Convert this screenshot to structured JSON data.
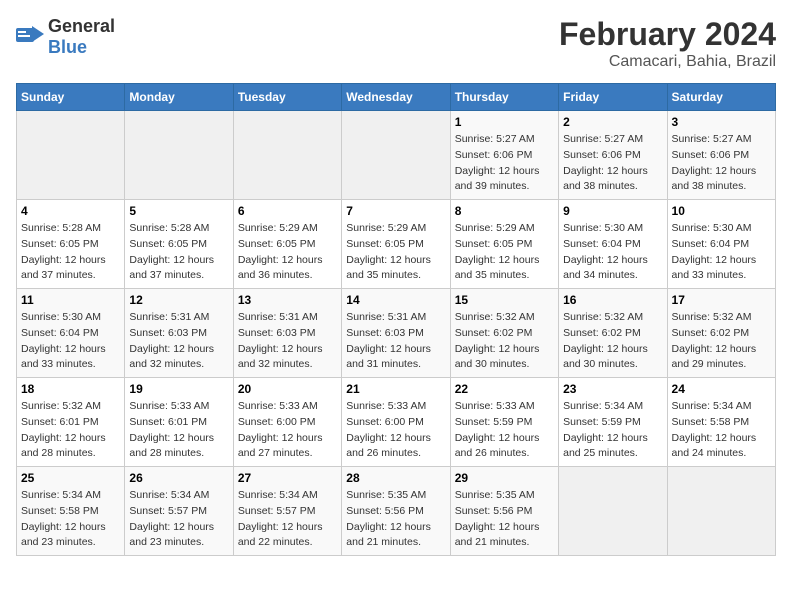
{
  "header": {
    "logo_general": "General",
    "logo_blue": "Blue",
    "month_year": "February 2024",
    "location": "Camacari, Bahia, Brazil"
  },
  "columns": [
    "Sunday",
    "Monday",
    "Tuesday",
    "Wednesday",
    "Thursday",
    "Friday",
    "Saturday"
  ],
  "weeks": [
    [
      {
        "day": "",
        "info": ""
      },
      {
        "day": "",
        "info": ""
      },
      {
        "day": "",
        "info": ""
      },
      {
        "day": "",
        "info": ""
      },
      {
        "day": "1",
        "info": "Sunrise: 5:27 AM\nSunset: 6:06 PM\nDaylight: 12 hours\nand 39 minutes."
      },
      {
        "day": "2",
        "info": "Sunrise: 5:27 AM\nSunset: 6:06 PM\nDaylight: 12 hours\nand 38 minutes."
      },
      {
        "day": "3",
        "info": "Sunrise: 5:27 AM\nSunset: 6:06 PM\nDaylight: 12 hours\nand 38 minutes."
      }
    ],
    [
      {
        "day": "4",
        "info": "Sunrise: 5:28 AM\nSunset: 6:05 PM\nDaylight: 12 hours\nand 37 minutes."
      },
      {
        "day": "5",
        "info": "Sunrise: 5:28 AM\nSunset: 6:05 PM\nDaylight: 12 hours\nand 37 minutes."
      },
      {
        "day": "6",
        "info": "Sunrise: 5:29 AM\nSunset: 6:05 PM\nDaylight: 12 hours\nand 36 minutes."
      },
      {
        "day": "7",
        "info": "Sunrise: 5:29 AM\nSunset: 6:05 PM\nDaylight: 12 hours\nand 35 minutes."
      },
      {
        "day": "8",
        "info": "Sunrise: 5:29 AM\nSunset: 6:05 PM\nDaylight: 12 hours\nand 35 minutes."
      },
      {
        "day": "9",
        "info": "Sunrise: 5:30 AM\nSunset: 6:04 PM\nDaylight: 12 hours\nand 34 minutes."
      },
      {
        "day": "10",
        "info": "Sunrise: 5:30 AM\nSunset: 6:04 PM\nDaylight: 12 hours\nand 33 minutes."
      }
    ],
    [
      {
        "day": "11",
        "info": "Sunrise: 5:30 AM\nSunset: 6:04 PM\nDaylight: 12 hours\nand 33 minutes."
      },
      {
        "day": "12",
        "info": "Sunrise: 5:31 AM\nSunset: 6:03 PM\nDaylight: 12 hours\nand 32 minutes."
      },
      {
        "day": "13",
        "info": "Sunrise: 5:31 AM\nSunset: 6:03 PM\nDaylight: 12 hours\nand 32 minutes."
      },
      {
        "day": "14",
        "info": "Sunrise: 5:31 AM\nSunset: 6:03 PM\nDaylight: 12 hours\nand 31 minutes."
      },
      {
        "day": "15",
        "info": "Sunrise: 5:32 AM\nSunset: 6:02 PM\nDaylight: 12 hours\nand 30 minutes."
      },
      {
        "day": "16",
        "info": "Sunrise: 5:32 AM\nSunset: 6:02 PM\nDaylight: 12 hours\nand 30 minutes."
      },
      {
        "day": "17",
        "info": "Sunrise: 5:32 AM\nSunset: 6:02 PM\nDaylight: 12 hours\nand 29 minutes."
      }
    ],
    [
      {
        "day": "18",
        "info": "Sunrise: 5:32 AM\nSunset: 6:01 PM\nDaylight: 12 hours\nand 28 minutes."
      },
      {
        "day": "19",
        "info": "Sunrise: 5:33 AM\nSunset: 6:01 PM\nDaylight: 12 hours\nand 28 minutes."
      },
      {
        "day": "20",
        "info": "Sunrise: 5:33 AM\nSunset: 6:00 PM\nDaylight: 12 hours\nand 27 minutes."
      },
      {
        "day": "21",
        "info": "Sunrise: 5:33 AM\nSunset: 6:00 PM\nDaylight: 12 hours\nand 26 minutes."
      },
      {
        "day": "22",
        "info": "Sunrise: 5:33 AM\nSunset: 5:59 PM\nDaylight: 12 hours\nand 26 minutes."
      },
      {
        "day": "23",
        "info": "Sunrise: 5:34 AM\nSunset: 5:59 PM\nDaylight: 12 hours\nand 25 minutes."
      },
      {
        "day": "24",
        "info": "Sunrise: 5:34 AM\nSunset: 5:58 PM\nDaylight: 12 hours\nand 24 minutes."
      }
    ],
    [
      {
        "day": "25",
        "info": "Sunrise: 5:34 AM\nSunset: 5:58 PM\nDaylight: 12 hours\nand 23 minutes."
      },
      {
        "day": "26",
        "info": "Sunrise: 5:34 AM\nSunset: 5:57 PM\nDaylight: 12 hours\nand 23 minutes."
      },
      {
        "day": "27",
        "info": "Sunrise: 5:34 AM\nSunset: 5:57 PM\nDaylight: 12 hours\nand 22 minutes."
      },
      {
        "day": "28",
        "info": "Sunrise: 5:35 AM\nSunset: 5:56 PM\nDaylight: 12 hours\nand 21 minutes."
      },
      {
        "day": "29",
        "info": "Sunrise: 5:35 AM\nSunset: 5:56 PM\nDaylight: 12 hours\nand 21 minutes."
      },
      {
        "day": "",
        "info": ""
      },
      {
        "day": "",
        "info": ""
      }
    ]
  ]
}
